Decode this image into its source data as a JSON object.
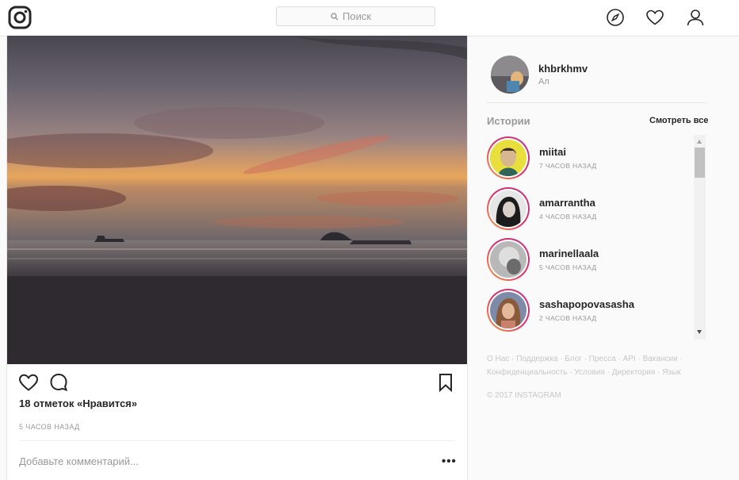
{
  "header": {
    "search_placeholder": "Поиск",
    "icons": [
      "instagram-logo",
      "compass-icon",
      "heart-icon",
      "person-icon"
    ]
  },
  "post": {
    "likes": "18 отметок «Нравится»",
    "time": "5 ЧАСОВ НАЗАД",
    "comment_placeholder": "Добавьте комментарий...",
    "more": "•••"
  },
  "profile": {
    "username": "khbrkhmv",
    "name": "Ал"
  },
  "stories": {
    "title": "Истории",
    "see_all": "Смотреть все",
    "items": [
      {
        "username": "miitai",
        "time": "7 ЧАСОВ НАЗАД"
      },
      {
        "username": "amarrantha",
        "time": "4 ЧАСОВ НАЗАД"
      },
      {
        "username": "marinellaala",
        "time": "5 ЧАСОВ НАЗАД"
      },
      {
        "username": "sashapopovasasha",
        "time": "2 ЧАСОВ НАЗАД"
      }
    ]
  },
  "footer": {
    "links": [
      "О Нас",
      "Поддержка",
      "Блог",
      "Пресса",
      "API",
      "Вакансии",
      "Конфиденциальность",
      "Условия",
      "Директория",
      "Язык"
    ],
    "copyright": "© 2017 INSTAGRAM"
  },
  "colors": {
    "story_ring": "#e1306c",
    "background": "#fafafa",
    "muted_text": "#999999"
  }
}
